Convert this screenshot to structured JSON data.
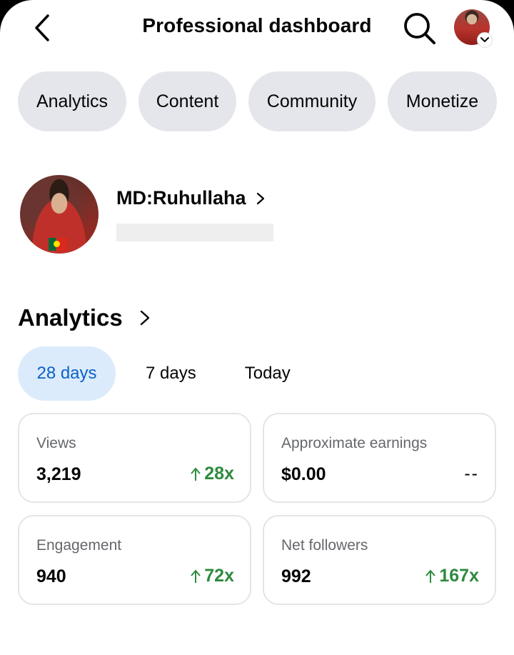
{
  "header": {
    "title": "Professional dashboard",
    "back_icon": "chevron-left-icon",
    "search_icon": "search-icon",
    "account_icon": "avatar"
  },
  "chips": [
    {
      "label": "Analytics"
    },
    {
      "label": "Content"
    },
    {
      "label": "Community"
    },
    {
      "label": "Monetize"
    }
  ],
  "profile": {
    "name": "MD:Ruhullaha"
  },
  "analytics": {
    "title": "Analytics",
    "tabs": [
      {
        "label": "28 days",
        "active": true
      },
      {
        "label": "7 days",
        "active": false
      },
      {
        "label": "Today",
        "active": false
      }
    ],
    "cards": [
      {
        "label": "Views",
        "value": "3,219",
        "change": "28x",
        "trend": "up"
      },
      {
        "label": "Approximate earnings",
        "value": "$0.00",
        "change": "--",
        "trend": "none"
      },
      {
        "label": "Engagement",
        "value": "940",
        "change": "72x",
        "trend": "up"
      },
      {
        "label": "Net followers",
        "value": "992",
        "change": "167x",
        "trend": "up"
      }
    ]
  },
  "colors": {
    "chip_bg": "#e4e6eb",
    "tab_active_bg": "#dcebfb",
    "tab_active_text": "#0b62c7",
    "positive": "#2e8b3e",
    "card_border": "#e3e5e8"
  }
}
